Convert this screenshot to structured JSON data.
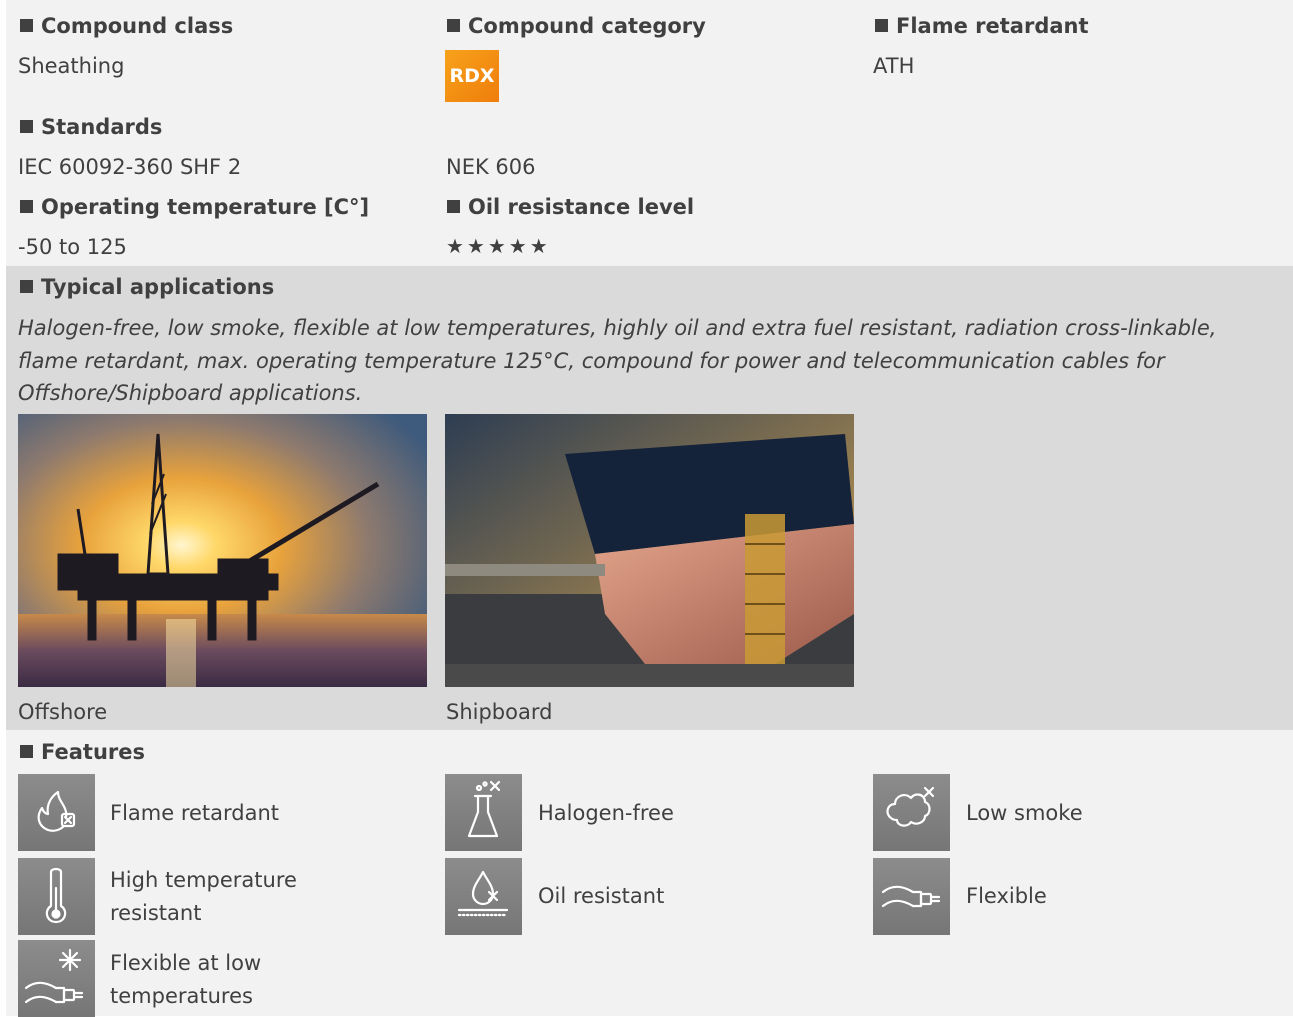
{
  "compound_class": {
    "label": "Compound class",
    "value": "Sheathing"
  },
  "compound_category": {
    "label": "Compound category",
    "badge": "RDX",
    "badge_color": "#f39214"
  },
  "flame_retardant": {
    "label": "Flame retardant",
    "value": "ATH"
  },
  "standards": {
    "label": "Standards",
    "items": [
      "IEC 60092-360 SHF 2",
      "NEK 606"
    ]
  },
  "operating_temperature": {
    "label": "Operating temperature [C°]",
    "value": "-50 to 125"
  },
  "oil_resistance": {
    "label": "Oil resistance level",
    "stars": "★★★★★",
    "rating": 5,
    "max": 5
  },
  "typical_applications": {
    "label": "Typical applications",
    "text": "Halogen-free, low smoke, flexible at low temperatures, highly oil and extra fuel resistant, radiation cross-linkable, flame retardant, max. operating temperature 125°C, compound for power and telecommunication cables for Offshore/Shipboard applications.",
    "images": [
      {
        "caption": "Offshore",
        "icon": "offshore-platform-photo"
      },
      {
        "caption": "Shipboard",
        "icon": "ship-drydock-photo"
      }
    ]
  },
  "features": {
    "label": "Features",
    "items": [
      {
        "label": "Flame retardant",
        "icon": "flame-retardant-icon"
      },
      {
        "label": "Halogen-free",
        "icon": "halogen-free-icon"
      },
      {
        "label": "Low smoke",
        "icon": "low-smoke-icon"
      },
      {
        "label": "High temperature resistant",
        "icon": "thermometer-icon"
      },
      {
        "label": "Oil resistant",
        "icon": "oil-drop-icon"
      },
      {
        "label": "Flexible",
        "icon": "flexible-cable-icon"
      },
      {
        "label": "Flexible at low temperatures",
        "icon": "snowflake-cable-icon"
      }
    ]
  },
  "colors": {
    "text": "#404040",
    "band_light": "#f2f2f2",
    "band_dark": "#dadada",
    "icon_bg": "#808080"
  }
}
